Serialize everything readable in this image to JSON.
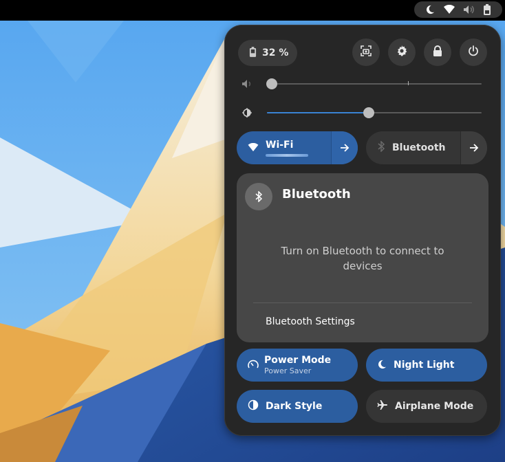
{
  "topbar": {
    "status_icons": [
      "night-light-icon",
      "wifi-icon",
      "volume-icon",
      "battery-icon"
    ]
  },
  "quick_settings": {
    "battery": {
      "label": "32 %",
      "icon": "battery-icon"
    },
    "system_buttons": [
      {
        "name": "screenshot-button",
        "icon": "screenshot-icon"
      },
      {
        "name": "settings-button",
        "icon": "gear-icon"
      },
      {
        "name": "lock-button",
        "icon": "lock-icon"
      },
      {
        "name": "power-button",
        "icon": "power-icon"
      }
    ],
    "volume": {
      "level": 0.0,
      "icon": "volume-icon"
    },
    "brightness": {
      "level": 0.47,
      "icon": "brightness-icon"
    },
    "wifi": {
      "label": "Wi-Fi",
      "active": true
    },
    "bluetooth_toggle": {
      "label": "Bluetooth",
      "active": false
    },
    "bluetooth_menu": {
      "title": "Bluetooth",
      "message": "Turn on Bluetooth to connect to devices",
      "settings_label": "Bluetooth Settings"
    },
    "power_mode": {
      "label": "Power Mode",
      "sublabel": "Power Saver",
      "active": true
    },
    "night_light": {
      "label": "Night Light",
      "active": true
    },
    "dark_style": {
      "label": "Dark Style",
      "active": true
    },
    "airplane_mode": {
      "label": "Airplane Mode",
      "active": false
    }
  },
  "colors": {
    "accent": "#2c5ea0",
    "panel": "#262626",
    "inactive": "#353535",
    "menu": "#474747"
  }
}
